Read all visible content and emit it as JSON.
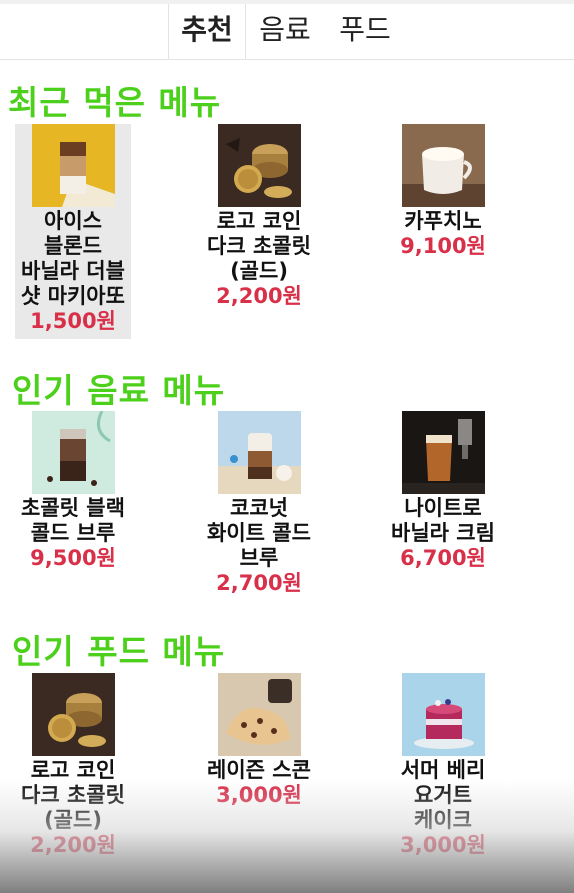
{
  "tabs": [
    {
      "label": "추천"
    },
    {
      "label": "음료"
    },
    {
      "label": "푸드"
    }
  ],
  "sections": {
    "recent": {
      "title": "최근 먹은 메뉴",
      "items": [
        {
          "name_lines": [
            "아이스",
            "블론드",
            "바닐라 더블",
            "샷 마키아또"
          ],
          "price": "1,500원",
          "image": "iced-macchiato-image"
        },
        {
          "name_lines": [
            "로고 코인",
            "다크 초콜릿",
            "(골드)"
          ],
          "price": "2,200원",
          "image": "coin-chocolate-image"
        },
        {
          "name_lines": [
            "카푸치노"
          ],
          "price": "9,100원",
          "image": "cappuccino-image"
        }
      ]
    },
    "drinks": {
      "title": "인기 음료 메뉴",
      "items": [
        {
          "name_lines": [
            "초콜릿 블랙",
            "콜드 브루"
          ],
          "price": "9,500원",
          "image": "chocolate-cold-brew-image"
        },
        {
          "name_lines": [
            "코코넛",
            "화이트 콜드",
            "브루"
          ],
          "price": "2,700원",
          "image": "coconut-cold-brew-image"
        },
        {
          "name_lines": [
            "나이트로",
            "바닐라 크림"
          ],
          "price": "6,700원",
          "image": "nitro-vanilla-image"
        }
      ]
    },
    "food": {
      "title": "인기 푸드 메뉴",
      "items": [
        {
          "name_lines": [
            "로고 코인",
            "다크 초콜릿",
            "(골드)"
          ],
          "price": "2,200원",
          "image": "coin-chocolate-image"
        },
        {
          "name_lines": [
            "레이즌 스콘"
          ],
          "price": "3,000원",
          "image": "raisin-scone-image"
        },
        {
          "name_lines": [
            "서머 베리",
            "요거트",
            "케이크"
          ],
          "price": "3,000원",
          "image": "berry-cake-image"
        }
      ]
    }
  },
  "colors": {
    "section_title": "#4cd01c",
    "price": "#d9304a"
  }
}
